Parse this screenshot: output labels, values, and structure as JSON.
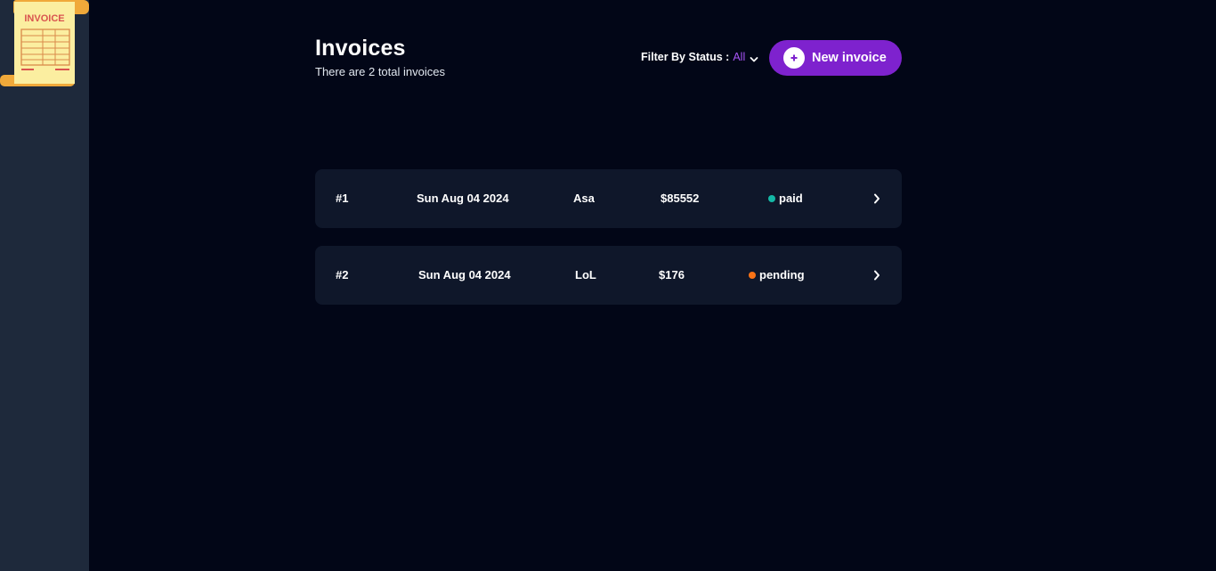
{
  "logo": {
    "text": "INVOICE"
  },
  "header": {
    "title": "Invoices",
    "subtitle": "There are 2 total invoices",
    "filter_label": "Filter By Status :",
    "filter_value": "All",
    "new_invoice_label": "New invoice"
  },
  "invoices": [
    {
      "id": "#1",
      "date": "Sun Aug 04 2024",
      "name": "Asa",
      "amount": "$85552",
      "status": "paid",
      "status_color": "#14b8a6"
    },
    {
      "id": "#2",
      "date": "Sun Aug 04 2024",
      "name": "LoL",
      "amount": "$176",
      "status": "pending",
      "status_color": "#f97316"
    }
  ],
  "colors": {
    "accent": "#7e22ce",
    "filter_value": "#a855f7",
    "sidebar": "#1e293b",
    "background": "#020617",
    "row": "#0f172a"
  }
}
